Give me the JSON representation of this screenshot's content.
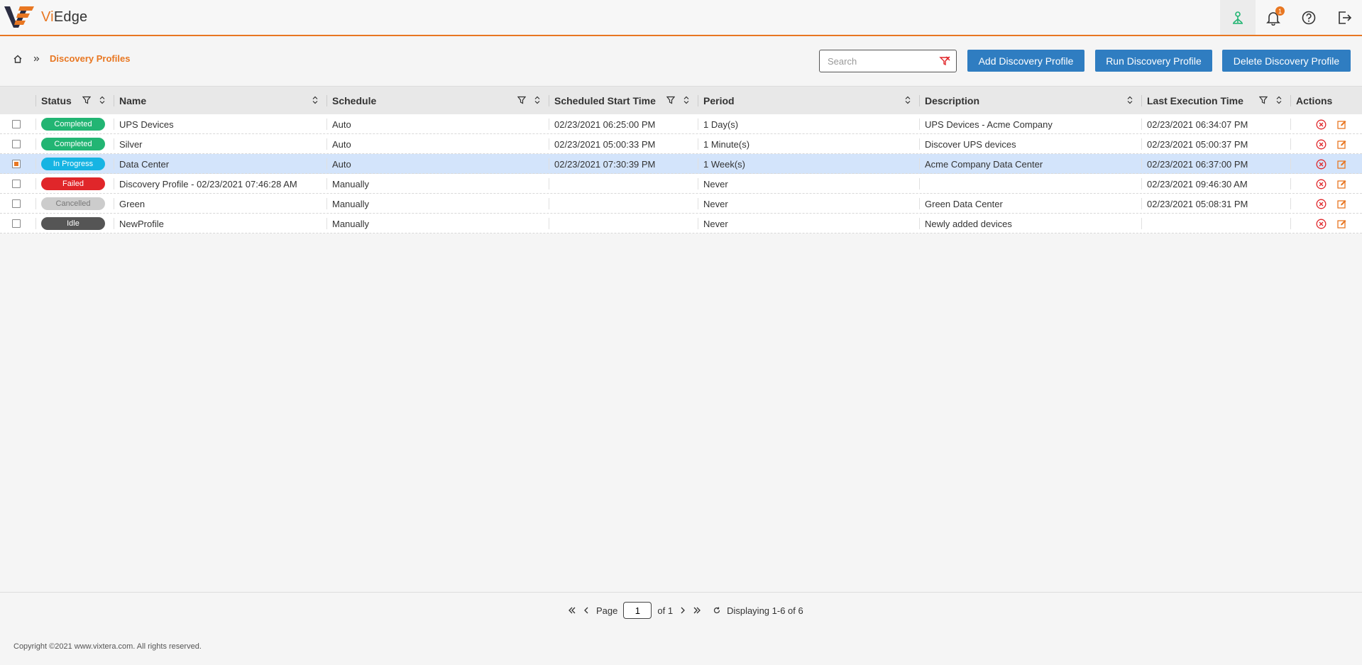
{
  "app": {
    "brand_prefix": "Vi",
    "brand_suffix": "Edge",
    "notification_count": "1"
  },
  "colors": {
    "accent": "#e87722",
    "button": "#2f7dc1",
    "completed": "#22b573",
    "in_progress": "#16b4e3",
    "failed": "#e0262a",
    "cancelled": "#cccccc",
    "idle": "#555555"
  },
  "breadcrumb": {
    "current": "Discovery Profiles"
  },
  "search": {
    "placeholder": "Search",
    "value": ""
  },
  "toolbar": {
    "add_label": "Add Discovery Profile",
    "run_label": "Run Discovery Profile",
    "delete_label": "Delete Discovery Profile"
  },
  "columns": {
    "status": "Status",
    "name": "Name",
    "schedule": "Schedule",
    "start": "Scheduled Start Time",
    "period": "Period",
    "description": "Description",
    "last": "Last Execution Time",
    "actions": "Actions"
  },
  "rows": [
    {
      "checked": false,
      "status": "Completed",
      "status_key": "completed",
      "name": "UPS Devices",
      "schedule": "Auto",
      "start": "02/23/2021 06:25:00 PM",
      "period": "1 Day(s)",
      "description": "UPS Devices - Acme Company",
      "last": "02/23/2021 06:34:07 PM"
    },
    {
      "checked": false,
      "status": "Completed",
      "status_key": "completed",
      "name": "Silver",
      "schedule": "Auto",
      "start": "02/23/2021 05:00:33 PM",
      "period": "1 Minute(s)",
      "description": "Discover UPS devices",
      "last": "02/23/2021 05:00:37 PM"
    },
    {
      "checked": true,
      "status": "In Progress",
      "status_key": "in_progress",
      "name": "Data Center",
      "schedule": "Auto",
      "start": "02/23/2021 07:30:39 PM",
      "period": "1 Week(s)",
      "description": "Acme Company Data Center",
      "last": "02/23/2021 06:37:00 PM"
    },
    {
      "checked": false,
      "status": "Failed",
      "status_key": "failed",
      "name": "Discovery Profile - 02/23/2021 07:46:28 AM",
      "schedule": "Manually",
      "start": "",
      "period": "Never",
      "description": "",
      "last": "02/23/2021 09:46:30 AM"
    },
    {
      "checked": false,
      "status": "Cancelled",
      "status_key": "cancelled",
      "name": "Green",
      "schedule": "Manually",
      "start": "",
      "period": "Never",
      "description": "Green Data Center",
      "last": "02/23/2021 05:08:31 PM"
    },
    {
      "checked": false,
      "status": "Idle",
      "status_key": "idle",
      "name": "NewProfile",
      "schedule": "Manually",
      "start": "",
      "period": "Never",
      "description": "Newly added devices",
      "last": ""
    }
  ],
  "pager": {
    "page_label": "Page",
    "page_value": "1",
    "of_label": "of 1",
    "display_label": "Displaying 1-6 of 6"
  },
  "footer": {
    "copyright": "Copyright ©2021 www.vixtera.com. All rights reserved."
  }
}
